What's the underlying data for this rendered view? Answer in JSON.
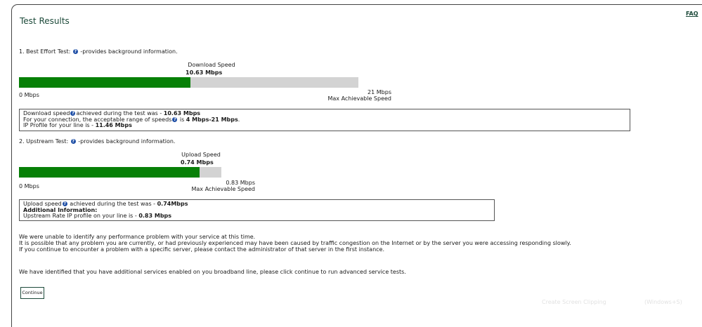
{
  "page": {
    "title": "Test Results",
    "faq_label": "FAQ"
  },
  "best_effort": {
    "heading_prefix": "1. Best Effort Test:",
    "heading_suffix": "-provides background information.",
    "gauge_title": "Download  Speed",
    "gauge_value": "10.63 Mbps",
    "min_label": "0 Mbps",
    "max_label": "21 Mbps",
    "max_caption": "Max Achievable Speed",
    "fill_fraction": 0.506,
    "info": {
      "line1_prefix": "Download speed",
      "line1_middle": "achieved during the test was - ",
      "line1_value": "10.63 Mbps",
      "line2_prefix": "For your connection, the acceptable range of speeds",
      "line2_middle": " is ",
      "line2_value": "4 Mbps-21 Mbps",
      "line2_end": ".",
      "line3_prefix": "IP Profile for your line is - ",
      "line3_value": "11.46 Mbps"
    }
  },
  "upstream": {
    "heading_prefix": "2. Upstream Test:",
    "heading_suffix": "-provides background information.",
    "gauge_title": "Upload Speed",
    "gauge_value": "0.74 Mbps",
    "min_label": "0 Mbps",
    "max_label": "0.83 Mbps",
    "max_caption": "Max Achievable Speed",
    "fill_fraction": 0.891,
    "info": {
      "line1_prefix": "Upload speed",
      "line1_middle": " achieved during the test was - ",
      "line1_value": "0.74Mbps",
      "line2": "Additional Information:",
      "line3_prefix": "Upstream Rate IP profile on your line is - ",
      "line3_value": "0.83 Mbps"
    }
  },
  "messages": {
    "line1": "We were unable to identify any performance problem with your service at this time.",
    "line2": "It is possible that any problem you are currently, or had previously experienced may have been caused by traffic congestion on the Internet or by the server you were accessing responding slowly.",
    "line3": "If you continue to encounter a problem with a specific server, please contact the administrator of that server in the first instance.",
    "additional": "We have identified that you have additional services enabled on you broadband line, please click continue to run advanced service tests."
  },
  "continue_label": "Continue",
  "overlay": {
    "clip_label": "Create Screen Clipping",
    "shortcut": "(Windows+S)"
  },
  "colors": {
    "bar_fill": "#078007",
    "bar_track": "#d3d3d3",
    "help_icon": "#1f4fa6",
    "title": "#1d4a3a"
  },
  "icons": {
    "help": "question-circle-icon"
  }
}
